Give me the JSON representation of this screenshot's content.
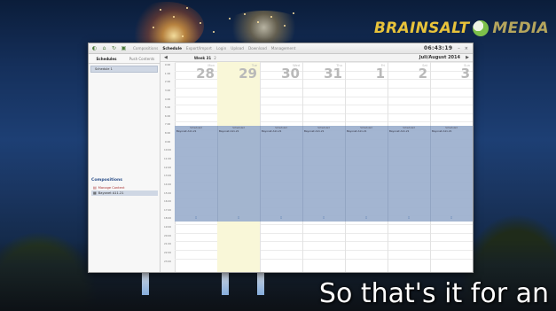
{
  "logo": {
    "brand": "BRAINSALT",
    "suffix": "MEDIA"
  },
  "caption": "So that's it for an",
  "window": {
    "menu": [
      {
        "label": "Compositions",
        "active": false
      },
      {
        "label": "Schedule",
        "active": true
      },
      {
        "label": "Export/Import",
        "active": false
      },
      {
        "label": "Login",
        "active": false
      },
      {
        "label": "Upload",
        "active": false
      },
      {
        "label": "Download",
        "active": false
      },
      {
        "label": "Management",
        "active": false
      }
    ],
    "clock": "06:43:19",
    "minimize": "–",
    "close": "×"
  },
  "left": {
    "tabs": {
      "schedules": "Schedules",
      "push": "Push Contents"
    },
    "schedule_item": "Schedule 1",
    "compositions_title": "Compositions",
    "compositions": [
      {
        "label": "Manage Content",
        "selected": false
      },
      {
        "label": "Bayonet A11.21",
        "selected": true
      }
    ]
  },
  "calendar": {
    "prev": "◀",
    "next": "▶",
    "week": "Week 31",
    "week_next": "2",
    "month": "Juli/August 2014",
    "days": [
      {
        "name": "Mon",
        "num": "28",
        "today": false
      },
      {
        "name": "Tue",
        "num": "29",
        "today": true
      },
      {
        "name": "Wed",
        "num": "30",
        "today": false
      },
      {
        "name": "Thu",
        "num": "31",
        "today": false
      },
      {
        "name": "Fri",
        "num": "1",
        "today": false
      },
      {
        "name": "Sat",
        "num": "2",
        "today": false
      },
      {
        "name": "Sun",
        "num": "3",
        "today": false
      }
    ],
    "times": [
      "0:00",
      "1:00",
      "2:00",
      "3:00",
      "4:00",
      "5:00",
      "6:00",
      "7:00",
      "8:00",
      "9:00",
      "10:00",
      "11:00",
      "12:00",
      "13:00",
      "14:00",
      "15:00",
      "16:00",
      "17:00",
      "18:00",
      "19:00",
      "20:00",
      "21:00",
      "22:00",
      "23:00"
    ],
    "event": {
      "header": "Scheduled",
      "name": "Bayonet A11.21"
    }
  }
}
